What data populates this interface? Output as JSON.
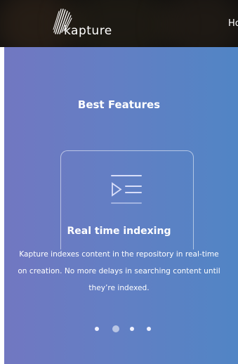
{
  "header": {
    "logo_text": "kapture",
    "nav_home_label": "Ho"
  },
  "features": {
    "title": "Best Features",
    "active_slide": 1,
    "slide_count": 4,
    "card": {
      "icon": "indexing-list-icon",
      "title": "Real time indexing",
      "description": "Kapture indexes content in the repository in real-time on creation. No more delays in searching content until they’re indexed."
    }
  },
  "colors": {
    "header_bg": "#0d0d0d",
    "gradient_start": "#7277c1",
    "gradient_end": "#5185c5",
    "text": "#ffffff"
  }
}
